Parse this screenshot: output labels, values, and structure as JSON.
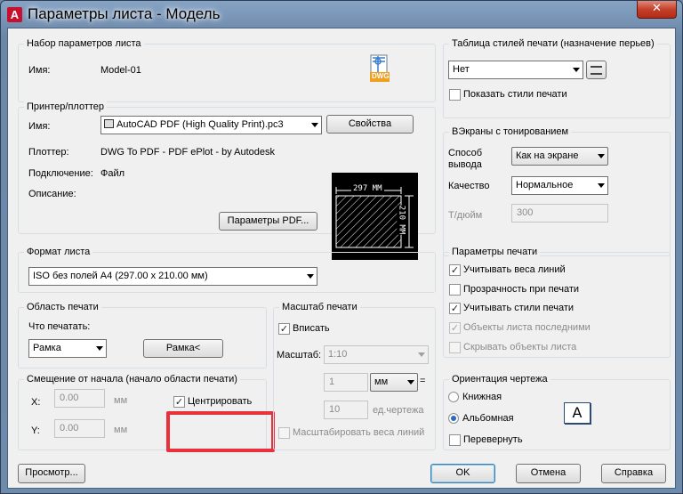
{
  "window": {
    "title": "Параметры листа - Модель",
    "close": "✕"
  },
  "pageset": {
    "legend": "Набор параметров листа",
    "name_label": "Имя:",
    "name_value": "Model-01",
    "icon_text": "DWG"
  },
  "printer": {
    "legend": "Принтер/плоттер",
    "name_label": "Имя:",
    "name_value": "AutoCAD PDF (High Quality Print).pc3",
    "properties_btn": "Свойства",
    "plotter_label": "Плоттер:",
    "plotter_value": "DWG To PDF - PDF ePlot - by Autodesk",
    "connection_label": "Подключение:",
    "connection_value": "Файл",
    "description_label": "Описание:",
    "pdf_btn": "Параметры PDF...",
    "dim_w": "297 ММ",
    "dim_h": "210 ММ"
  },
  "paper": {
    "legend": "Формат листа",
    "value": "ISO без полей A4 (297.00 x 210.00 мм)"
  },
  "area": {
    "legend": "Область печати",
    "what_label": "Что печатать:",
    "what_value": "Рамка",
    "frame_btn": "Рамка<"
  },
  "offset": {
    "legend": "Смещение от начала (начало области печати)",
    "x_label": "X:",
    "x_value": "0.00",
    "y_label": "Y:",
    "y_value": "0.00",
    "unit": "мм",
    "center_label": "Центрировать",
    "center_checked": "✓"
  },
  "scale": {
    "legend": "Масштаб печати",
    "fit_label": "Вписать",
    "fit_checked": "✓",
    "scale_label": "Масштаб:",
    "scale_value": "1:10",
    "val1": "1",
    "unit_value": "мм",
    "eq": "=",
    "val2": "10",
    "unit2": "ед.чертежа",
    "lineweights_label": "Масштабировать веса линий"
  },
  "styles": {
    "legend": "Таблица стилей печати (назначение перьев)",
    "value": "Нет",
    "show_label": "Показать стили печати"
  },
  "shaded": {
    "legend": "ВЭкраны с тонированием",
    "mode_label_1": "Способ",
    "mode_label_2": "вывода",
    "mode_value": "Как на экране",
    "quality_label": "Качество",
    "quality_value": "Нормальное",
    "dpi_label": "Т/дюйм",
    "dpi_value": "300"
  },
  "options": {
    "legend": "Параметры печати",
    "items": [
      {
        "label": "Учитывать веса линий",
        "check": "✓"
      },
      {
        "label": "Прозрачность при печати",
        "check": ""
      },
      {
        "label": "Учитывать стили печати",
        "check": "✓"
      },
      {
        "label": "Объекты листа последними",
        "check": "✓"
      },
      {
        "label": "Скрывать объекты листа",
        "check": ""
      }
    ]
  },
  "orientation": {
    "legend": "Ориентация чертежа",
    "portrait": "Книжная",
    "landscape": "Альбомная",
    "upside": "Перевернуть",
    "glyph": "A"
  },
  "buttons": {
    "preview": "Просмотр...",
    "ok": "OK",
    "cancel": "Отмена",
    "help": "Справка"
  }
}
